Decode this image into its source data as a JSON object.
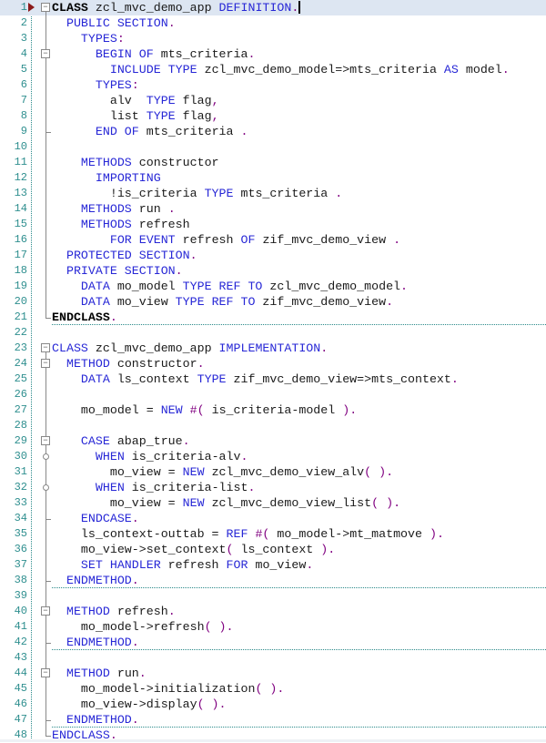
{
  "editor": {
    "language": "ABAP",
    "current_line": 1,
    "lines": [
      {
        "n": "1",
        "tokens": [
          [
            "kwb",
            "CLASS"
          ],
          [
            "t",
            " zcl_mvc_demo_app "
          ],
          [
            "kw",
            "DEFINITION"
          ],
          [
            "p",
            "."
          ]
        ]
      },
      {
        "n": "2",
        "tokens": [
          [
            "t",
            "  "
          ],
          [
            "kw",
            "PUBLIC SECTION"
          ],
          [
            "p",
            "."
          ]
        ]
      },
      {
        "n": "3",
        "tokens": [
          [
            "t",
            "    "
          ],
          [
            "kw",
            "TYPES"
          ],
          [
            "p",
            ":"
          ]
        ]
      },
      {
        "n": "4",
        "tokens": [
          [
            "t",
            "      "
          ],
          [
            "kw",
            "BEGIN OF"
          ],
          [
            "t",
            " mts_criteria"
          ],
          [
            "p",
            "."
          ]
        ]
      },
      {
        "n": "5",
        "tokens": [
          [
            "t",
            "        "
          ],
          [
            "kw",
            "INCLUDE TYPE"
          ],
          [
            "t",
            " zcl_mvc_demo_model=>mts_criteria "
          ],
          [
            "kw",
            "AS"
          ],
          [
            "t",
            " model"
          ],
          [
            "p",
            "."
          ]
        ]
      },
      {
        "n": "6",
        "tokens": [
          [
            "t",
            "      "
          ],
          [
            "kw",
            "TYPES"
          ],
          [
            "p",
            ":"
          ]
        ]
      },
      {
        "n": "7",
        "tokens": [
          [
            "t",
            "        alv  "
          ],
          [
            "kw",
            "TYPE"
          ],
          [
            "t",
            " flag"
          ],
          [
            "p",
            ","
          ]
        ]
      },
      {
        "n": "8",
        "tokens": [
          [
            "t",
            "        list "
          ],
          [
            "kw",
            "TYPE"
          ],
          [
            "t",
            " flag"
          ],
          [
            "p",
            ","
          ]
        ]
      },
      {
        "n": "9",
        "tokens": [
          [
            "t",
            "      "
          ],
          [
            "kw",
            "END OF"
          ],
          [
            "t",
            " mts_criteria "
          ],
          [
            "p",
            "."
          ]
        ]
      },
      {
        "n": "10",
        "tokens": []
      },
      {
        "n": "11",
        "tokens": [
          [
            "t",
            "    "
          ],
          [
            "kw",
            "METHODS"
          ],
          [
            "t",
            " constructor"
          ]
        ]
      },
      {
        "n": "12",
        "tokens": [
          [
            "t",
            "      "
          ],
          [
            "kw",
            "IMPORTING"
          ]
        ]
      },
      {
        "n": "13",
        "tokens": [
          [
            "t",
            "        !is_criteria "
          ],
          [
            "kw",
            "TYPE"
          ],
          [
            "t",
            " mts_criteria "
          ],
          [
            "p",
            "."
          ]
        ]
      },
      {
        "n": "14",
        "tokens": [
          [
            "t",
            "    "
          ],
          [
            "kw",
            "METHODS"
          ],
          [
            "t",
            " run "
          ],
          [
            "p",
            "."
          ]
        ]
      },
      {
        "n": "15",
        "tokens": [
          [
            "t",
            "    "
          ],
          [
            "kw",
            "METHODS"
          ],
          [
            "t",
            " refresh"
          ]
        ]
      },
      {
        "n": "16",
        "tokens": [
          [
            "t",
            "        "
          ],
          [
            "kw",
            "FOR EVENT"
          ],
          [
            "t",
            " refresh "
          ],
          [
            "kw",
            "OF"
          ],
          [
            "t",
            " zif_mvc_demo_view "
          ],
          [
            "p",
            "."
          ]
        ]
      },
      {
        "n": "17",
        "tokens": [
          [
            "t",
            "  "
          ],
          [
            "kw",
            "PROTECTED SECTION"
          ],
          [
            "p",
            "."
          ]
        ]
      },
      {
        "n": "18",
        "tokens": [
          [
            "t",
            "  "
          ],
          [
            "kw",
            "PRIVATE SECTION"
          ],
          [
            "p",
            "."
          ]
        ]
      },
      {
        "n": "19",
        "tokens": [
          [
            "t",
            "    "
          ],
          [
            "kw",
            "DATA"
          ],
          [
            "t",
            " mo_model "
          ],
          [
            "kw",
            "TYPE REF TO"
          ],
          [
            "t",
            " zcl_mvc_demo_model"
          ],
          [
            "p",
            "."
          ]
        ]
      },
      {
        "n": "20",
        "tokens": [
          [
            "t",
            "    "
          ],
          [
            "kw",
            "DATA"
          ],
          [
            "t",
            " mo_view "
          ],
          [
            "kw",
            "TYPE REF TO"
          ],
          [
            "t",
            " zif_mvc_demo_view"
          ],
          [
            "p",
            "."
          ]
        ]
      },
      {
        "n": "21",
        "tokens": [
          [
            "kwb",
            "ENDCLASS"
          ],
          [
            "p",
            "."
          ]
        ]
      },
      {
        "n": "22",
        "tokens": []
      },
      {
        "n": "23",
        "tokens": [
          [
            "kw",
            "CLASS"
          ],
          [
            "t",
            " zcl_mvc_demo_app "
          ],
          [
            "kw",
            "IMPLEMENTATION"
          ],
          [
            "p",
            "."
          ]
        ]
      },
      {
        "n": "24",
        "tokens": [
          [
            "t",
            "  "
          ],
          [
            "kw",
            "METHOD"
          ],
          [
            "t",
            " constructor"
          ],
          [
            "p",
            "."
          ]
        ]
      },
      {
        "n": "25",
        "tokens": [
          [
            "t",
            "    "
          ],
          [
            "kw",
            "DATA"
          ],
          [
            "t",
            " ls_context "
          ],
          [
            "kw",
            "TYPE"
          ],
          [
            "t",
            " zif_mvc_demo_view=>mts_context"
          ],
          [
            "p",
            "."
          ]
        ]
      },
      {
        "n": "26",
        "tokens": []
      },
      {
        "n": "27",
        "tokens": [
          [
            "t",
            "    mo_model = "
          ],
          [
            "kw",
            "NEW"
          ],
          [
            "t",
            " "
          ],
          [
            "p",
            "#("
          ],
          [
            "t",
            " is_criteria-model "
          ],
          [
            "p",
            ")."
          ]
        ]
      },
      {
        "n": "28",
        "tokens": []
      },
      {
        "n": "29",
        "tokens": [
          [
            "t",
            "    "
          ],
          [
            "kw",
            "CASE"
          ],
          [
            "t",
            " abap_true"
          ],
          [
            "p",
            "."
          ]
        ]
      },
      {
        "n": "30",
        "tokens": [
          [
            "t",
            "      "
          ],
          [
            "kw",
            "WHEN"
          ],
          [
            "t",
            " is_criteria-alv"
          ],
          [
            "p",
            "."
          ]
        ]
      },
      {
        "n": "31",
        "tokens": [
          [
            "t",
            "        mo_view = "
          ],
          [
            "kw",
            "NEW"
          ],
          [
            "t",
            " zcl_mvc_demo_view_alv"
          ],
          [
            "p",
            "( )."
          ]
        ]
      },
      {
        "n": "32",
        "tokens": [
          [
            "t",
            "      "
          ],
          [
            "kw",
            "WHEN"
          ],
          [
            "t",
            " is_criteria-list"
          ],
          [
            "p",
            "."
          ]
        ]
      },
      {
        "n": "33",
        "tokens": [
          [
            "t",
            "        mo_view = "
          ],
          [
            "kw",
            "NEW"
          ],
          [
            "t",
            " zcl_mvc_demo_view_list"
          ],
          [
            "p",
            "( )."
          ]
        ]
      },
      {
        "n": "34",
        "tokens": [
          [
            "t",
            "    "
          ],
          [
            "kw",
            "ENDCASE"
          ],
          [
            "p",
            "."
          ]
        ]
      },
      {
        "n": "35",
        "tokens": [
          [
            "t",
            "    ls_context-outtab = "
          ],
          [
            "kw",
            "REF"
          ],
          [
            "t",
            " "
          ],
          [
            "p",
            "#("
          ],
          [
            "t",
            " mo_model->mt_matmove "
          ],
          [
            "p",
            ")."
          ]
        ]
      },
      {
        "n": "36",
        "tokens": [
          [
            "t",
            "    mo_view->set_context"
          ],
          [
            "p",
            "("
          ],
          [
            "t",
            " ls_context "
          ],
          [
            "p",
            ")."
          ]
        ]
      },
      {
        "n": "37",
        "tokens": [
          [
            "t",
            "    "
          ],
          [
            "kw",
            "SET HANDLER"
          ],
          [
            "t",
            " refresh "
          ],
          [
            "kw",
            "FOR"
          ],
          [
            "t",
            " mo_view"
          ],
          [
            "p",
            "."
          ]
        ]
      },
      {
        "n": "38",
        "tokens": [
          [
            "t",
            "  "
          ],
          [
            "kw",
            "ENDMETHOD"
          ],
          [
            "p",
            "."
          ]
        ]
      },
      {
        "n": "39",
        "tokens": []
      },
      {
        "n": "40",
        "tokens": [
          [
            "t",
            "  "
          ],
          [
            "kw",
            "METHOD"
          ],
          [
            "t",
            " refresh"
          ],
          [
            "p",
            "."
          ]
        ]
      },
      {
        "n": "41",
        "tokens": [
          [
            "t",
            "    mo_model->refresh"
          ],
          [
            "p",
            "( )."
          ]
        ]
      },
      {
        "n": "42",
        "tokens": [
          [
            "t",
            "  "
          ],
          [
            "kw",
            "ENDMETHOD"
          ],
          [
            "p",
            "."
          ]
        ]
      },
      {
        "n": "43",
        "tokens": []
      },
      {
        "n": "44",
        "tokens": [
          [
            "t",
            "  "
          ],
          [
            "kw",
            "METHOD"
          ],
          [
            "t",
            " run"
          ],
          [
            "p",
            "."
          ]
        ]
      },
      {
        "n": "45",
        "tokens": [
          [
            "t",
            "    mo_model->initialization"
          ],
          [
            "p",
            "( )."
          ]
        ]
      },
      {
        "n": "46",
        "tokens": [
          [
            "t",
            "    mo_view->display"
          ],
          [
            "p",
            "( )."
          ]
        ]
      },
      {
        "n": "47",
        "tokens": [
          [
            "t",
            "  "
          ],
          [
            "kw",
            "ENDMETHOD"
          ],
          [
            "p",
            "."
          ]
        ]
      },
      {
        "n": "48",
        "tokens": [
          [
            "kw",
            "ENDCLASS"
          ],
          [
            "p",
            "."
          ]
        ]
      }
    ],
    "fold_open": [
      "1",
      "4",
      "23",
      "24",
      "29",
      "40",
      "44"
    ],
    "fold_end": [
      "9",
      "21",
      "34",
      "38",
      "42",
      "47",
      "48"
    ],
    "fold_branch": [
      "30",
      "32"
    ],
    "separators_after": [
      "21",
      "38",
      "42",
      "47"
    ]
  },
  "colors": {
    "keyword": "#2727d6",
    "punct": "#800080",
    "line_number": "#2f8f8f",
    "current_line_bg": "#dde6f2",
    "breakpoint_marker": "#8b1a1a"
  }
}
